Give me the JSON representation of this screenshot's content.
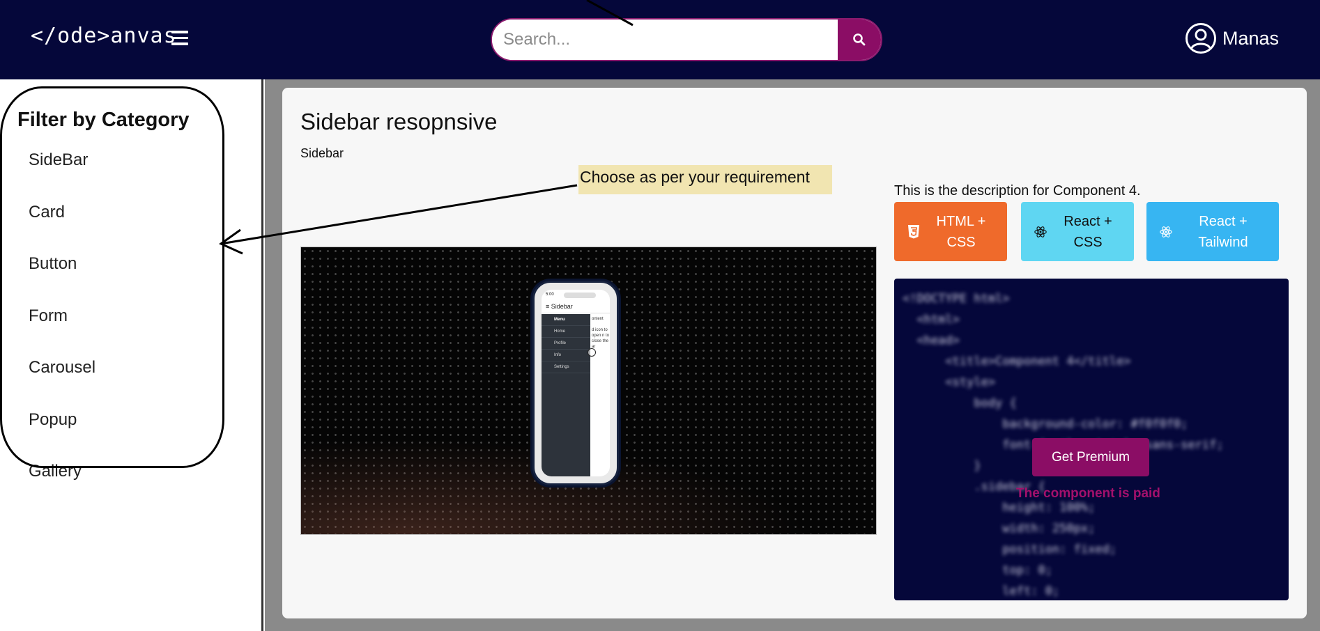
{
  "header": {
    "logo_text": "</ode>anvas",
    "search_placeholder": "Search...",
    "search_icon": "search-icon",
    "menu_icon": "hamburger-icon",
    "user_icon": "user-circle-icon",
    "user_name": "Manas",
    "colors": {
      "background": "#05073a",
      "accent": "#8b0d65"
    }
  },
  "sidebar": {
    "title": "Filter by Category",
    "items": [
      "SideBar",
      "Card",
      "Button",
      "Form",
      "Carousel",
      "Popup",
      "Gallery"
    ]
  },
  "annotation": {
    "label": "Choose as per your requirement"
  },
  "component": {
    "title": "Sidebar resopnsive",
    "subtitle": "Sidebar",
    "description": "This is the description for Component 4."
  },
  "buttons": {
    "html_css": {
      "label": "HTML + CSS",
      "icon": "html5-icon",
      "color": "#ef6a2b"
    },
    "react_css": {
      "label": "React + CSS",
      "icon": "react-icon",
      "color": "#5fd6f2"
    },
    "react_tailwind": {
      "label": "React + Tailwind",
      "icon": "react-icon",
      "color": "#37b5f2"
    }
  },
  "preview": {
    "phone_time": "5:00",
    "app_title": "Sidebar",
    "menu_title": "Menu",
    "menu_items": [
      "Home",
      "Profile",
      "Info",
      "Settings"
    ],
    "content_heading": "ontent",
    "content_text": "d icon to open n to close the ar"
  },
  "code": {
    "lines": [
      "<!DOCTYPE html>",
      "  <html>",
      "  <head>",
      "      <title>Component 4</title>",
      "      <style>",
      "          body {",
      "              background-color: #f0f0f0;",
      "              font-family: Arial, sans-serif;",
      "          }",
      "          .sidebar {",
      "              height: 100%;",
      "              width: 250px;",
      "              position: fixed;",
      "              top: 0;",
      "              left: 0;"
    ],
    "premium_button": "Get Premium",
    "paid_notice": "The component is paid",
    "colors": {
      "background": "#05073a",
      "premium": "#8b0d65",
      "paid_text": "#a3106c"
    }
  }
}
